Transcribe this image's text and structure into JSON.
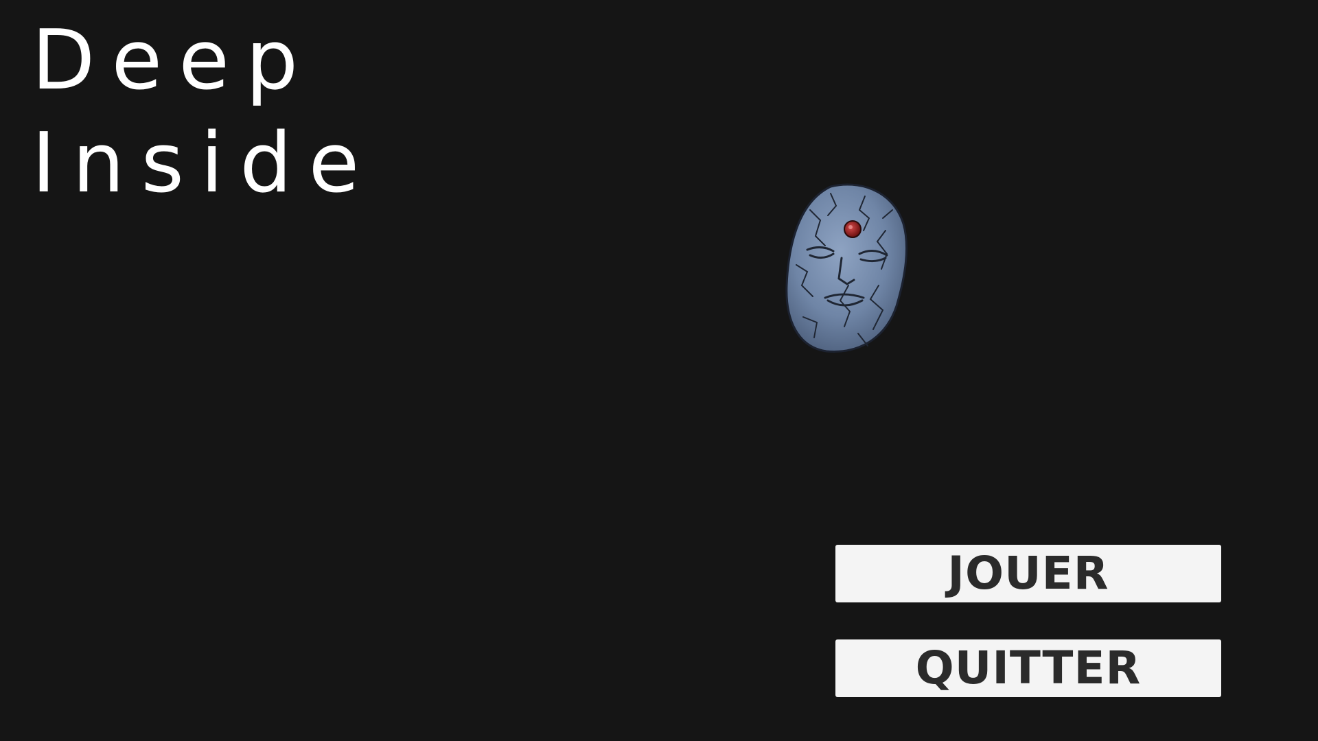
{
  "title": {
    "line1": "Deep",
    "line2": "Inside"
  },
  "menu": {
    "play_label": "JOUER",
    "quit_label": "QUITTER"
  },
  "mask": {
    "icon": "stone-mask-icon",
    "stone_color": "#6f85a6",
    "gem_color": "#9b1c1c"
  },
  "colors": {
    "background": "#151515",
    "title_text": "#ffffff",
    "button_bg": "#f4f4f4",
    "button_text": "#2b2b2b"
  }
}
